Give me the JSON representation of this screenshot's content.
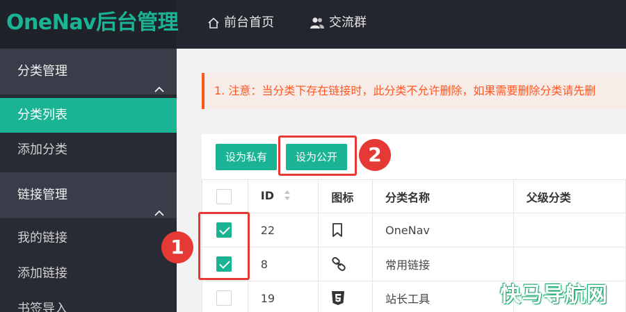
{
  "header": {
    "logo": "OneNav后台管理",
    "nav": [
      {
        "label": "前台首页",
        "icon": "home-icon"
      },
      {
        "label": "交流群",
        "icon": "users-icon"
      }
    ]
  },
  "sidebar": {
    "groups": [
      {
        "label": "分类管理",
        "icon": "chevron-up-icon",
        "items": [
          {
            "label": "分类列表",
            "active": true
          },
          {
            "label": "添加分类",
            "active": false
          }
        ]
      },
      {
        "label": "链接管理",
        "icon": "chevron-up-icon",
        "items": [
          {
            "label": "我的链接",
            "active": false
          },
          {
            "label": "添加链接",
            "active": false
          },
          {
            "label": "书签导入",
            "active": false
          }
        ]
      }
    ]
  },
  "main": {
    "notice": "1. 注意：当分类下存在链接时，此分类不允许删除，如果需要删除分类请先删",
    "toolbar": {
      "private_label": "设为私有",
      "public_label": "设为公开"
    },
    "annotations": [
      "1",
      "2"
    ],
    "table": {
      "headers": [
        "ID",
        "图标",
        "分类名称",
        "父级分类"
      ],
      "rows": [
        {
          "checked": true,
          "id": "22",
          "icon": "bookmark-icon",
          "name": "OneNav",
          "parent": ""
        },
        {
          "checked": true,
          "id": "8",
          "icon": "link-icon",
          "name": "常用链接",
          "parent": ""
        },
        {
          "checked": false,
          "id": "19",
          "icon": "html5-icon",
          "name": "站长工具",
          "parent": ""
        }
      ]
    }
  },
  "watermark": "快马导航网",
  "colors": {
    "accent": "#1ab394",
    "header_bg": "#23262e",
    "sidebar_bg": "#282b33",
    "group_bg": "#393d49",
    "warning": "#ff5722",
    "annotation": "#e53935"
  }
}
